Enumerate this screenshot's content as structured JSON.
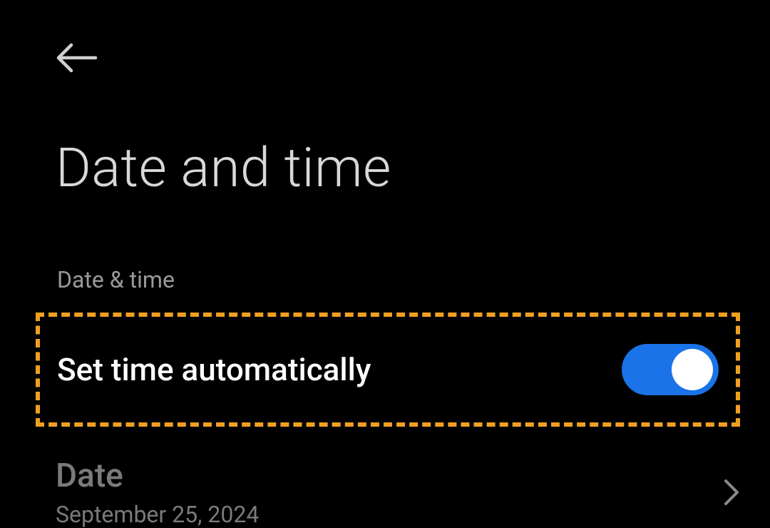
{
  "header": {
    "title": "Date and time"
  },
  "section": {
    "header": "Date & time"
  },
  "settings": {
    "auto_time": {
      "label": "Set time automatically",
      "enabled": true
    },
    "date": {
      "label": "Date",
      "value": "September 25, 2024"
    }
  }
}
